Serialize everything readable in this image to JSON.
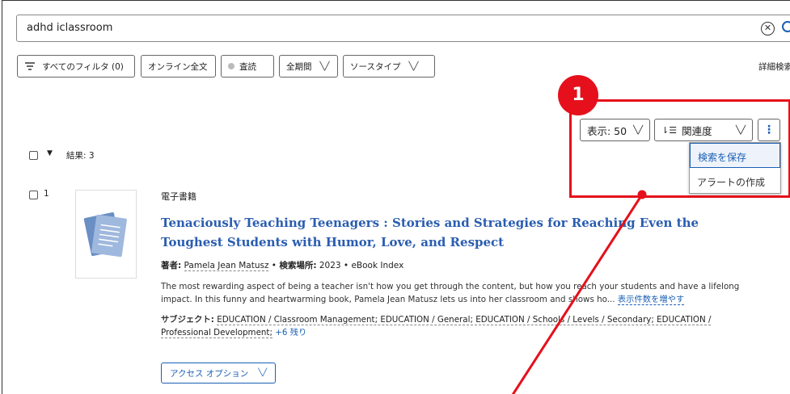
{
  "search": {
    "query": "adhd iclassroom"
  },
  "filters": [
    {
      "label": "すべてのフィルタ (0)",
      "icon": "filter-icon"
    },
    {
      "label": "オンライン全文"
    },
    {
      "label": "査読",
      "icon": "circle-icon"
    },
    {
      "label": "全期間",
      "dropdown": true
    },
    {
      "label": "ソースタイプ",
      "dropdown": true
    }
  ],
  "advanced_search": "詳細検索",
  "results_header": {
    "count_label": "結果: 3",
    "page_size": "表示: 50",
    "sort": "関連度"
  },
  "menu": {
    "items": [
      "検索を保存",
      "アラートの作成"
    ]
  },
  "result": {
    "index": "1",
    "type": "電子書籍",
    "title": "Tenaciously Teaching Teenagers : Stories and Strategies for Reaching Even the Toughest Students with Humor, Love, and Respect",
    "author_label": "著者:",
    "author": "Pamela Jean Matusz",
    "source_label": "検索場所:",
    "source": "2023 • eBook Index",
    "abstract": "The most rewarding aspect of being a teacher isn't how you get through the content, but how you reach your students and have a lifelong impact. In this funny and heartwarming book, Pamela Jean Matusz lets us into her classroom and shows ho...",
    "more_label": "表示件数を増やす",
    "subject_label": "サブジェクト:",
    "subjects": "EDUCATION / Classroom Management; EDUCATION / General; EDUCATION / Schools / Levels / Secondary; EDUCATION / Professional Development;",
    "subjects_more": "+6 残り",
    "access_label": "アクセス オプション"
  },
  "annotation": {
    "badge": "1",
    "color": "#e5101b"
  },
  "colors": {
    "link": "#1a5fb4",
    "title": "#2a5db0",
    "annotation": "#e5101b"
  }
}
